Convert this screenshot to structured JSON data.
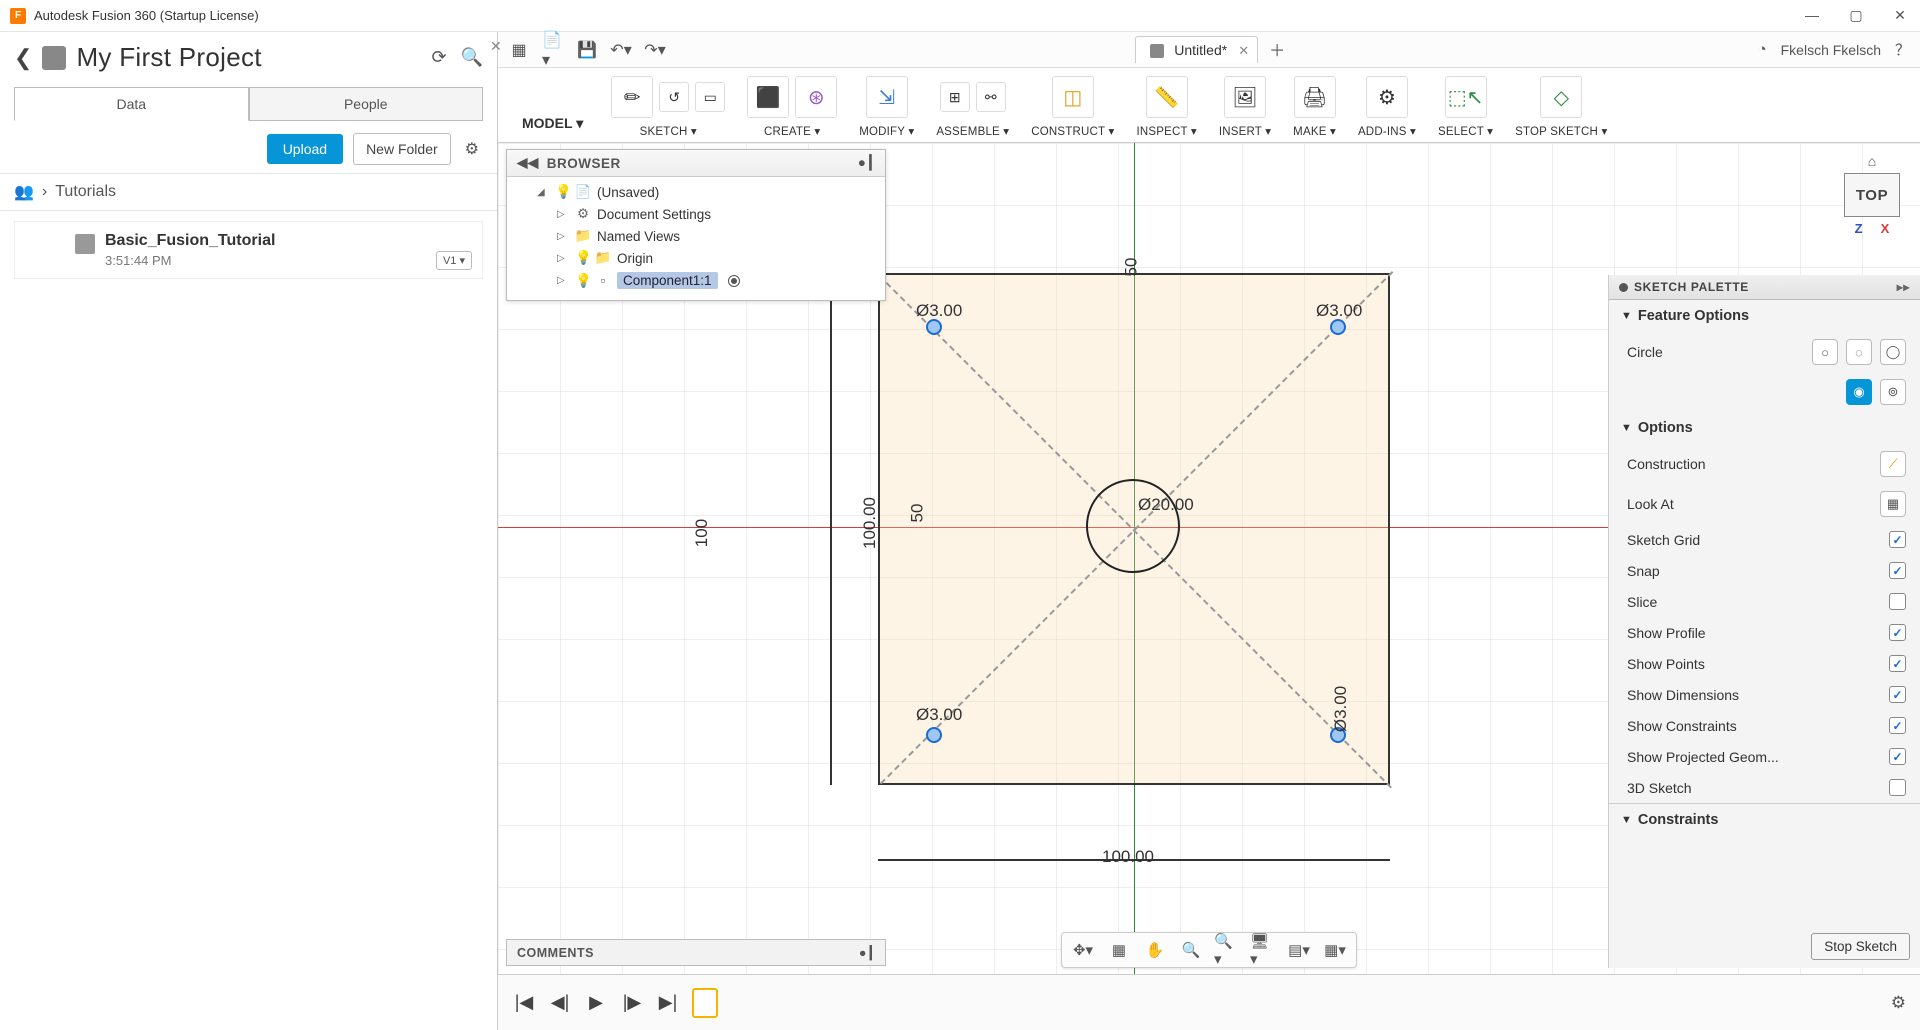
{
  "app": {
    "title": "Autodesk Fusion 360 (Startup License)",
    "logo_letter": "F"
  },
  "win": {
    "min": "—",
    "max": "▢",
    "close": "✕"
  },
  "data_panel": {
    "project_title": "My First Project",
    "tabs": {
      "data": "Data",
      "people": "People"
    },
    "upload": "Upload",
    "new_folder": "New Folder",
    "crumb": "Tutorials",
    "file": {
      "name": "Basic_Fusion_Tutorial",
      "time": "3:51:44 PM",
      "version": "V1 ▾"
    }
  },
  "topstrip": {
    "doc_title": "Untitled*",
    "user": "Fkelsch Fkelsch"
  },
  "ribbon": {
    "mode": "MODEL ▾",
    "groups": {
      "sketch": "SKETCH ▾",
      "create": "CREATE ▾",
      "modify": "MODIFY ▾",
      "assemble": "ASSEMBLE ▾",
      "construct": "CONSTRUCT ▾",
      "inspect": "INSPECT ▾",
      "insert": "INSERT ▾",
      "make": "MAKE ▾",
      "addins": "ADD-INS ▾",
      "select": "SELECT ▾",
      "stop": "STOP SKETCH ▾"
    }
  },
  "browser": {
    "title": "BROWSER",
    "root": "(Unsaved)",
    "items": {
      "doc": "Document Settings",
      "views": "Named Views",
      "origin": "Origin",
      "comp": "Component1:1"
    }
  },
  "canvas": {
    "dim_h": "100.00",
    "dim_v": "100.00",
    "dim_50a": "50",
    "dim_50b": "50",
    "dim_100v": "100",
    "dia_big": "Ø20.00",
    "dia_tl": "Ø3.00",
    "dia_tr": "Ø3.00",
    "dia_bl": "Ø3.00",
    "dia_br": "Ø3.00",
    "viewcube": "TOP",
    "axis_x": "X",
    "axis_z": "Z"
  },
  "palette": {
    "title": "SKETCH PALETTE",
    "feature_opts": "Feature Options",
    "circle": "Circle",
    "options": "Options",
    "rows": {
      "construction": "Construction",
      "lookat": "Look At",
      "grid": "Sketch Grid",
      "snap": "Snap",
      "slice": "Slice",
      "profile": "Show Profile",
      "points": "Show Points",
      "dims": "Show Dimensions",
      "constraints": "Show Constraints",
      "projected": "Show Projected Geom...",
      "sk3d": "3D Sketch"
    },
    "constraints_h": "Constraints",
    "stop": "Stop Sketch"
  },
  "comments": "COMMENTS"
}
